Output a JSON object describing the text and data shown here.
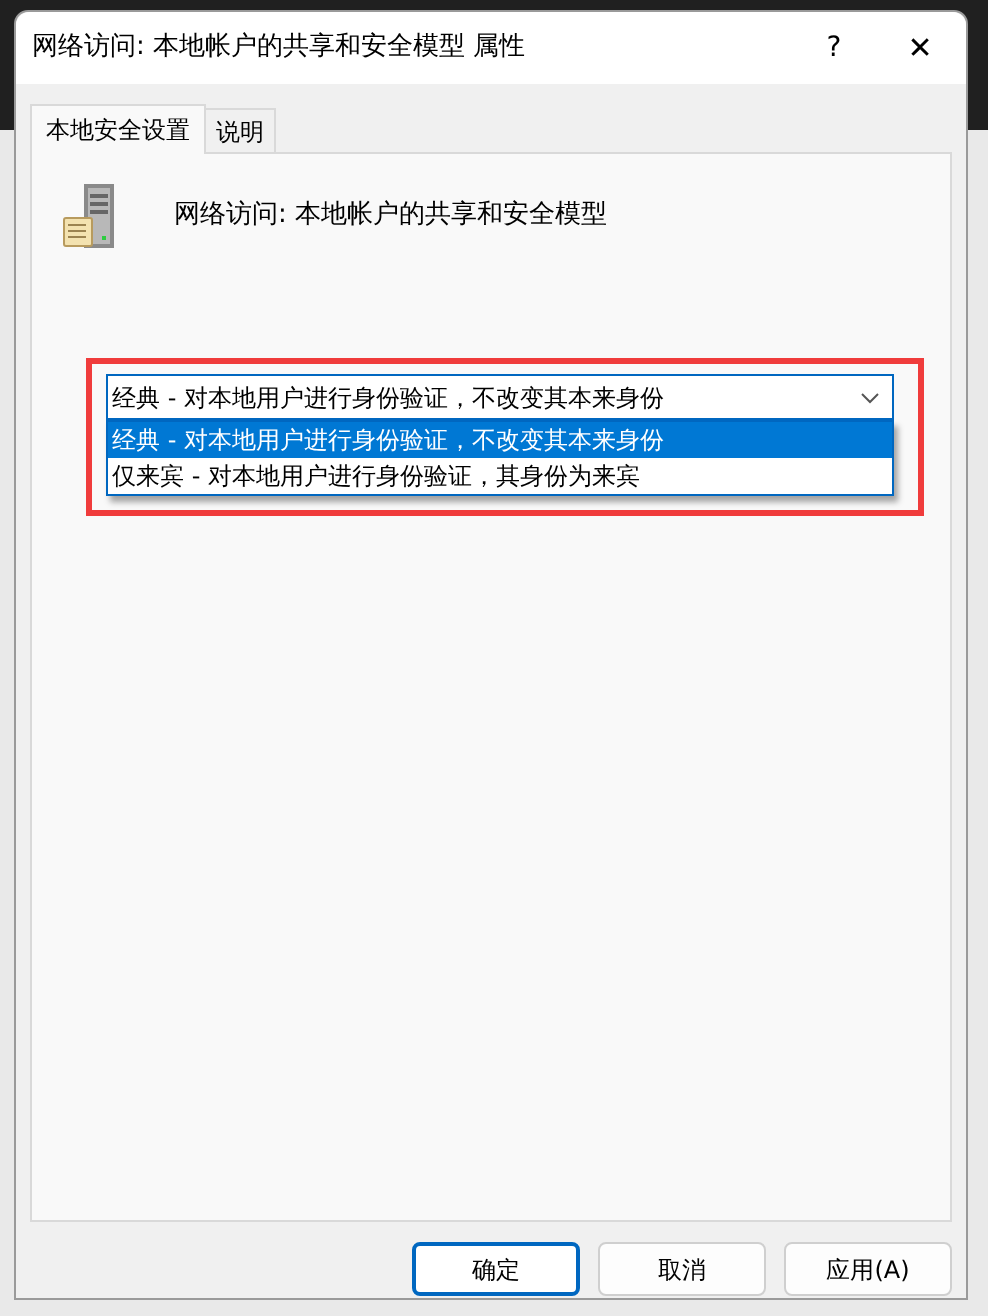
{
  "window": {
    "title": "网络访问: 本地帐户的共享和安全模型 属性",
    "help": "?",
    "close": "✕"
  },
  "tabs": [
    {
      "label": "本地安全设置",
      "selected": true
    },
    {
      "label": "说明",
      "selected": false
    }
  ],
  "policy_name": "网络访问: 本地帐户的共享和安全模型",
  "dropdown": {
    "value": "经典 - 对本地用户进行身份验证，不改变其本来身份",
    "expanded": true,
    "options": [
      {
        "label": "经典 - 对本地用户进行身份验证，不改变其本来身份",
        "selected": true
      },
      {
        "label": "仅来宾 - 对本地用户进行身份验证，其身份为来宾",
        "selected": false
      }
    ]
  },
  "buttons": [
    {
      "label": "确定",
      "default": true
    },
    {
      "label": "取消",
      "default": false
    },
    {
      "label": "应用(A)",
      "default": false
    }
  ]
}
